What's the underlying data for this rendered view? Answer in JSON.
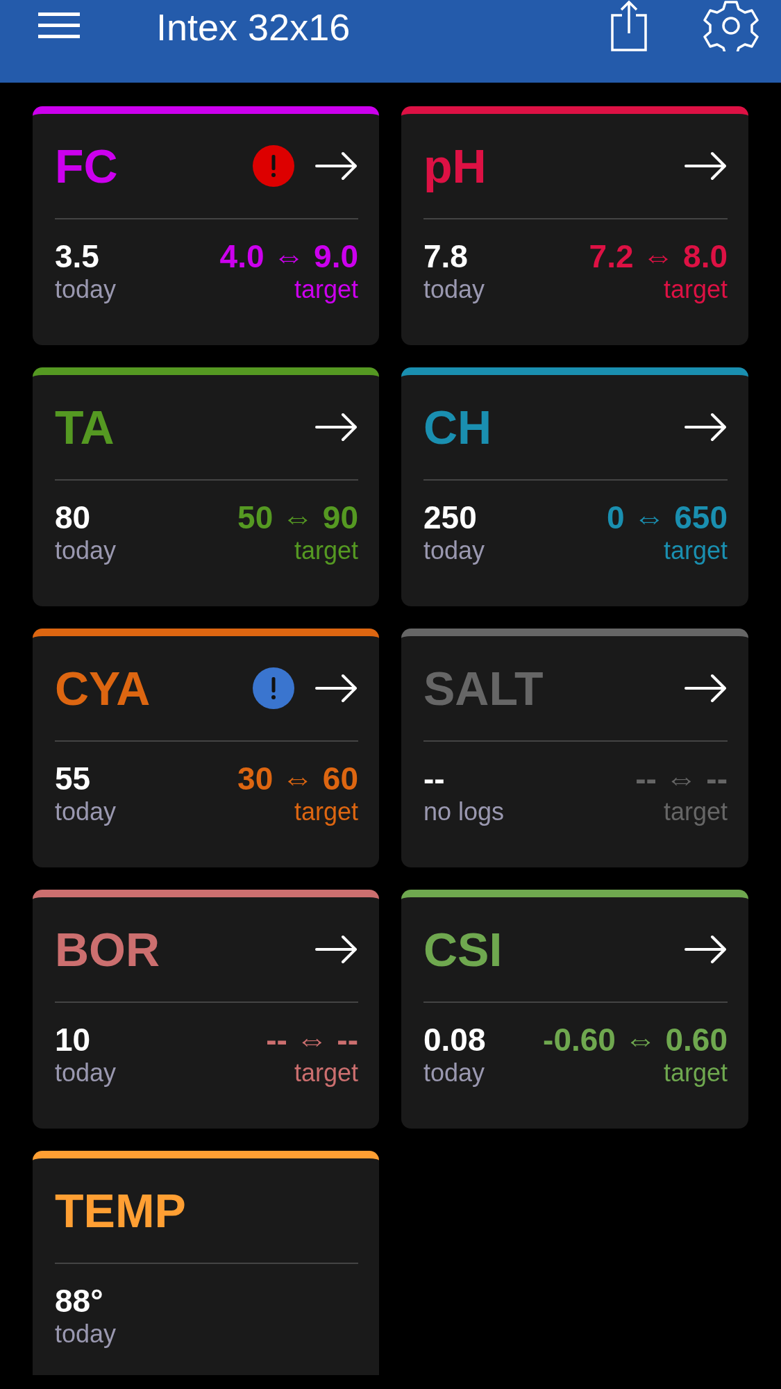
{
  "header": {
    "title": "Intex 32x16"
  },
  "cards": [
    {
      "title": "FC",
      "color": "#cc00ee",
      "alert": {
        "color": "#dd0000"
      },
      "arrow": true,
      "value": "3.5",
      "value_label": "today",
      "target": "4.0 ⇔ 9.0",
      "target_label": "target"
    },
    {
      "title": "pH",
      "color": "#dd1144",
      "arrow": true,
      "value": "7.8",
      "value_label": "today",
      "target": "7.2 ⇔ 8.0",
      "target_label": "target"
    },
    {
      "title": "TA",
      "color": "#559922",
      "arrow": true,
      "value": "80",
      "value_label": "today",
      "target": "50 ⇔ 90",
      "target_label": "target"
    },
    {
      "title": "CH",
      "color": "#1a8fb0",
      "arrow": true,
      "value": "250",
      "value_label": "today",
      "target": "0 ⇔ 650",
      "target_label": "target"
    },
    {
      "title": "CYA",
      "color": "#dd6611",
      "alert": {
        "color": "#3a75cf"
      },
      "arrow": true,
      "value": "55",
      "value_label": "today",
      "target": "30 ⇔ 60",
      "target_label": "target"
    },
    {
      "title": "SALT",
      "color": "#666666",
      "arrow": true,
      "value": "--",
      "value_label": "no logs",
      "target": "-- ⇔ --",
      "target_label": "target"
    },
    {
      "title": "BOR",
      "color": "#cc6f6f",
      "arrow": true,
      "value": "10",
      "value_label": "today",
      "target": "-- ⇔ --",
      "target_label": "target"
    },
    {
      "title": "CSI",
      "color": "#6fa84f",
      "arrow": true,
      "value": "0.08",
      "value_label": "today",
      "target": "-0.60 ⇔ 0.60",
      "target_label": "target"
    },
    {
      "title": "TEMP",
      "color": "#ff9f33",
      "arrow": false,
      "value": "88°",
      "value_label": "today"
    }
  ]
}
